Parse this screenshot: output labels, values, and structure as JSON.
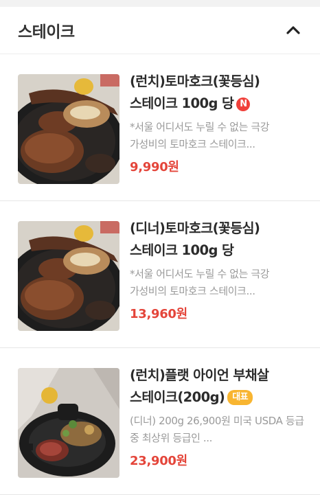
{
  "section": {
    "title": "스테이크",
    "collapse_icon": "chevron-up-icon"
  },
  "items": [
    {
      "name": "(런치)토마호크(꽃등심)스테이크 100g 당",
      "badge": "N",
      "badge_color": "#f0403a",
      "description": "*서울 어디서도 누릴 수 없는 극강 가성비의 토마호크 스테이크...",
      "price": "9,990원"
    },
    {
      "name": "(디너)토마호크(꽃등심)스테이크 100g 당",
      "description": "*서울 어디서도 누릴 수 없는 극강 가성비의 토마호크 스테이크...",
      "price": "13,960원"
    },
    {
      "name": "(런치)플랫 아이언 부채살 스테이크(200g)",
      "badge": "대표",
      "badge_color": "#f8b531",
      "description": "(디너) 200g 26,900원 미국 USDA 등급 중 최상위 등급인 ...",
      "price": "23,900원"
    }
  ],
  "colors": {
    "price": "#e4453a",
    "title": "#333333",
    "description": "#9a9a9a"
  }
}
